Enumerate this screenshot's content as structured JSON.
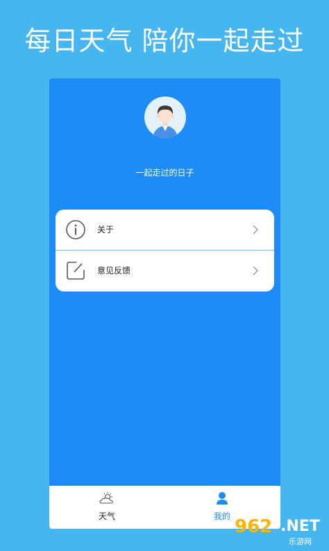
{
  "banner": {
    "text": "每日天气 陪你一起走过"
  },
  "profile": {
    "subtitle": "一起走过的日子"
  },
  "menu": {
    "items": [
      {
        "label": "关于",
        "icon": "info-icon"
      },
      {
        "label": "意见反馈",
        "icon": "edit-note-icon"
      }
    ]
  },
  "tabbar": {
    "tabs": [
      {
        "label": "天气",
        "icon": "weather-icon",
        "active": false
      },
      {
        "label": "我的",
        "icon": "user-icon",
        "active": true
      }
    ]
  },
  "watermark": {
    "number": "962",
    "net": ".NET",
    "site": "乐游网"
  },
  "colors": {
    "page_bg": "#45b6f0",
    "phone_bg": "#1e8cf7",
    "active_tab": "#1e8cf7",
    "inactive_tab": "#222222"
  }
}
